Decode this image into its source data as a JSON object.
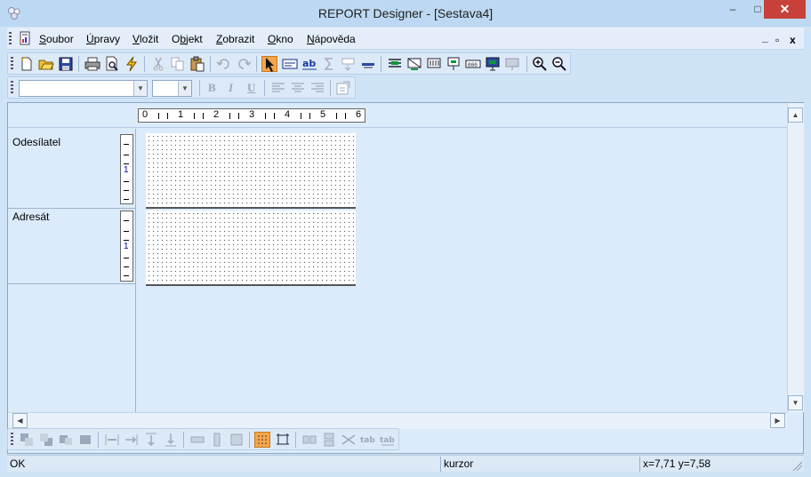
{
  "window": {
    "title": "REPORT Designer - [Sestava4]",
    "minimize_glyph": "–",
    "maximize_glyph": "□",
    "close_glyph": "✕"
  },
  "menu": {
    "items": [
      {
        "accel": "S",
        "rest": "oubor"
      },
      {
        "accel": "Ú",
        "rest": "pravy"
      },
      {
        "accel": "V",
        "rest": "ložit"
      },
      {
        "pre": "O",
        "accel": "b",
        "rest": "jekt"
      },
      {
        "accel": "Z",
        "rest": "obrazit"
      },
      {
        "accel": "O",
        "rest": "kno"
      },
      {
        "accel": "N",
        "rest": "ápověda"
      }
    ],
    "mdi_minimize": "_",
    "mdi_restore": "▫",
    "mdi_close": "x"
  },
  "format_toolbar": {
    "font_value": "",
    "size_value": "",
    "bold": "B",
    "italic": "I",
    "underline": "U"
  },
  "ruler": {
    "labels": [
      "0",
      "1",
      "2",
      "3",
      "4",
      "5",
      "6"
    ]
  },
  "bands": [
    {
      "label": "Odesílatel",
      "ruler_num": "1"
    },
    {
      "label": "Adresát",
      "ruler_num": "1"
    }
  ],
  "status": {
    "message": "OK",
    "mode": "kurzor",
    "coords": "x=7,71   y=7,58"
  },
  "colors": {
    "accent": "#f5a54a",
    "title_bar": "#bcd8f2",
    "close_button": "#c7413a"
  },
  "icons": {
    "standard": [
      "new-document-icon",
      "open-folder-icon",
      "save-icon",
      "print-icon",
      "print-preview-icon",
      "lightning-icon",
      "cut-icon",
      "copy-icon",
      "paste-icon",
      "undo-icon",
      "redo-icon",
      "pointer-icon",
      "field-icon",
      "text-ab-icon",
      "sum-icon",
      "function-icon",
      "line-icon",
      "band-header-icon",
      "band-group-icon",
      "band-detail-icon",
      "band-footer-icon",
      "band-summary-icon",
      "band-page-icon",
      "band-end-icon",
      "zoom-in-icon",
      "zoom-out-icon"
    ],
    "layout": [
      "bring-front-icon",
      "send-back-icon",
      "align-group-icon",
      "align-group2-icon",
      "space-horiz-icon",
      "space-horiz2-icon",
      "space-vert-icon",
      "space-vert2-icon",
      "size-width-icon",
      "size-height-icon",
      "size-both-icon",
      "grid-icon",
      "snap-icon",
      "center-horiz-icon",
      "center-vert-icon",
      "spread-icon",
      "tab-order-icon",
      "tab-order2-icon"
    ]
  }
}
